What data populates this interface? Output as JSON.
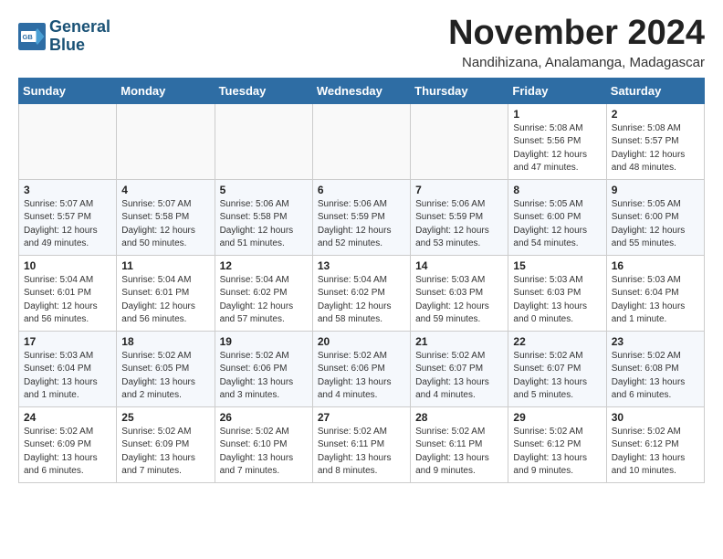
{
  "header": {
    "logo_line1": "General",
    "logo_line2": "Blue",
    "month": "November 2024",
    "location": "Nandihizana, Analamanga, Madagascar"
  },
  "weekdays": [
    "Sunday",
    "Monday",
    "Tuesday",
    "Wednesday",
    "Thursday",
    "Friday",
    "Saturday"
  ],
  "weeks": [
    [
      {
        "day": "",
        "info": ""
      },
      {
        "day": "",
        "info": ""
      },
      {
        "day": "",
        "info": ""
      },
      {
        "day": "",
        "info": ""
      },
      {
        "day": "",
        "info": ""
      },
      {
        "day": "1",
        "info": "Sunrise: 5:08 AM\nSunset: 5:56 PM\nDaylight: 12 hours\nand 47 minutes."
      },
      {
        "day": "2",
        "info": "Sunrise: 5:08 AM\nSunset: 5:57 PM\nDaylight: 12 hours\nand 48 minutes."
      }
    ],
    [
      {
        "day": "3",
        "info": "Sunrise: 5:07 AM\nSunset: 5:57 PM\nDaylight: 12 hours\nand 49 minutes."
      },
      {
        "day": "4",
        "info": "Sunrise: 5:07 AM\nSunset: 5:58 PM\nDaylight: 12 hours\nand 50 minutes."
      },
      {
        "day": "5",
        "info": "Sunrise: 5:06 AM\nSunset: 5:58 PM\nDaylight: 12 hours\nand 51 minutes."
      },
      {
        "day": "6",
        "info": "Sunrise: 5:06 AM\nSunset: 5:59 PM\nDaylight: 12 hours\nand 52 minutes."
      },
      {
        "day": "7",
        "info": "Sunrise: 5:06 AM\nSunset: 5:59 PM\nDaylight: 12 hours\nand 53 minutes."
      },
      {
        "day": "8",
        "info": "Sunrise: 5:05 AM\nSunset: 6:00 PM\nDaylight: 12 hours\nand 54 minutes."
      },
      {
        "day": "9",
        "info": "Sunrise: 5:05 AM\nSunset: 6:00 PM\nDaylight: 12 hours\nand 55 minutes."
      }
    ],
    [
      {
        "day": "10",
        "info": "Sunrise: 5:04 AM\nSunset: 6:01 PM\nDaylight: 12 hours\nand 56 minutes."
      },
      {
        "day": "11",
        "info": "Sunrise: 5:04 AM\nSunset: 6:01 PM\nDaylight: 12 hours\nand 56 minutes."
      },
      {
        "day": "12",
        "info": "Sunrise: 5:04 AM\nSunset: 6:02 PM\nDaylight: 12 hours\nand 57 minutes."
      },
      {
        "day": "13",
        "info": "Sunrise: 5:04 AM\nSunset: 6:02 PM\nDaylight: 12 hours\nand 58 minutes."
      },
      {
        "day": "14",
        "info": "Sunrise: 5:03 AM\nSunset: 6:03 PM\nDaylight: 12 hours\nand 59 minutes."
      },
      {
        "day": "15",
        "info": "Sunrise: 5:03 AM\nSunset: 6:03 PM\nDaylight: 13 hours\nand 0 minutes."
      },
      {
        "day": "16",
        "info": "Sunrise: 5:03 AM\nSunset: 6:04 PM\nDaylight: 13 hours\nand 1 minute."
      }
    ],
    [
      {
        "day": "17",
        "info": "Sunrise: 5:03 AM\nSunset: 6:04 PM\nDaylight: 13 hours\nand 1 minute."
      },
      {
        "day": "18",
        "info": "Sunrise: 5:02 AM\nSunset: 6:05 PM\nDaylight: 13 hours\nand 2 minutes."
      },
      {
        "day": "19",
        "info": "Sunrise: 5:02 AM\nSunset: 6:06 PM\nDaylight: 13 hours\nand 3 minutes."
      },
      {
        "day": "20",
        "info": "Sunrise: 5:02 AM\nSunset: 6:06 PM\nDaylight: 13 hours\nand 4 minutes."
      },
      {
        "day": "21",
        "info": "Sunrise: 5:02 AM\nSunset: 6:07 PM\nDaylight: 13 hours\nand 4 minutes."
      },
      {
        "day": "22",
        "info": "Sunrise: 5:02 AM\nSunset: 6:07 PM\nDaylight: 13 hours\nand 5 minutes."
      },
      {
        "day": "23",
        "info": "Sunrise: 5:02 AM\nSunset: 6:08 PM\nDaylight: 13 hours\nand 6 minutes."
      }
    ],
    [
      {
        "day": "24",
        "info": "Sunrise: 5:02 AM\nSunset: 6:09 PM\nDaylight: 13 hours\nand 6 minutes."
      },
      {
        "day": "25",
        "info": "Sunrise: 5:02 AM\nSunset: 6:09 PM\nDaylight: 13 hours\nand 7 minutes."
      },
      {
        "day": "26",
        "info": "Sunrise: 5:02 AM\nSunset: 6:10 PM\nDaylight: 13 hours\nand 7 minutes."
      },
      {
        "day": "27",
        "info": "Sunrise: 5:02 AM\nSunset: 6:11 PM\nDaylight: 13 hours\nand 8 minutes."
      },
      {
        "day": "28",
        "info": "Sunrise: 5:02 AM\nSunset: 6:11 PM\nDaylight: 13 hours\nand 9 minutes."
      },
      {
        "day": "29",
        "info": "Sunrise: 5:02 AM\nSunset: 6:12 PM\nDaylight: 13 hours\nand 9 minutes."
      },
      {
        "day": "30",
        "info": "Sunrise: 5:02 AM\nSunset: 6:12 PM\nDaylight: 13 hours\nand 10 minutes."
      }
    ]
  ]
}
